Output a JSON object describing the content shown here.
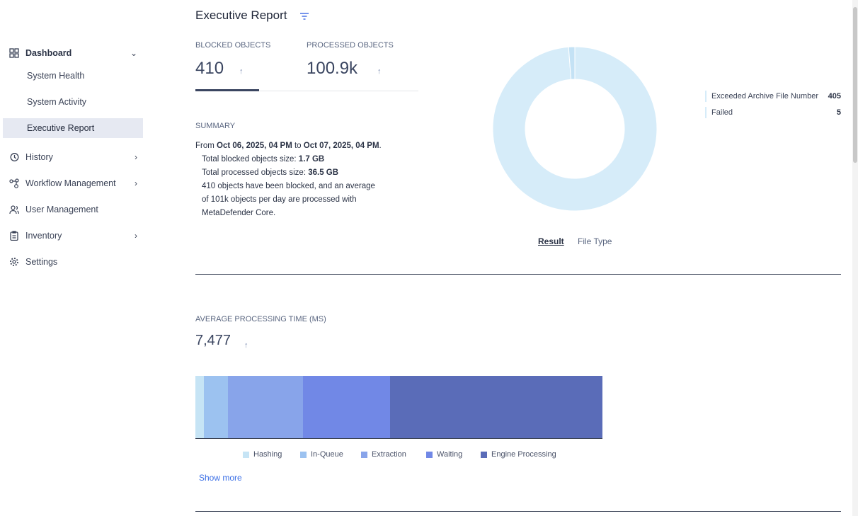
{
  "sidebar": {
    "items": [
      {
        "label": "Dashboard"
      },
      {
        "label": "System Health"
      },
      {
        "label": "System Activity"
      },
      {
        "label": "Executive Report"
      },
      {
        "label": "History"
      },
      {
        "label": "Workflow Management"
      },
      {
        "label": "User Management"
      },
      {
        "label": "Inventory"
      },
      {
        "label": "Settings"
      }
    ]
  },
  "header": {
    "title": "Executive Report"
  },
  "kpis": {
    "blocked_label": "BLOCKED OBJECTS",
    "blocked_value": "410",
    "processed_label": "PROCESSED OBJECTS",
    "processed_value": "100.9k",
    "arrow": "↑"
  },
  "summary": {
    "label": "SUMMARY",
    "from": "From ",
    "start": "Oct 06, 2025, 04 PM",
    "to": " to ",
    "end": "Oct 07, 2025, 04 PM",
    "end_punct": ".",
    "blocked_size_label": "Total blocked objects size: ",
    "blocked_size": "1.7 GB",
    "processed_size_label": "Total processed objects size: ",
    "processed_size": "36.5 GB",
    "line1": "410 objects have been blocked, and an average",
    "line2": "of 101k objects per day are processed with",
    "line3": "MetaDefender Core."
  },
  "donut": {
    "tabs": [
      "Result",
      "File Type"
    ],
    "active_tab": "Result"
  },
  "processing": {
    "label": "AVERAGE PROCESSING TIME (MS)",
    "value": "7,477",
    "arrow": "↑",
    "show_more": "Show more"
  },
  "chart_data": [
    {
      "type": "pie",
      "title": "Result",
      "categories": [
        "Exceeded Archive File Number",
        "Failed"
      ],
      "values": [
        405,
        5
      ],
      "colors": [
        "#d6ecf9",
        "#c4e2f5"
      ],
      "legend": "right"
    },
    {
      "type": "bar",
      "orientation": "horizontal-stacked",
      "title": "Average Processing Time (ms)",
      "categories": [
        "Hashing",
        "In-Queue",
        "Extraction",
        "Waiting",
        "Engine Processing"
      ],
      "values": [
        156,
        442,
        1378,
        1600,
        3901
      ],
      "colors": [
        "#c6e4f5",
        "#9cc2f0",
        "#88a4ea",
        "#7188e6",
        "#5a6cb8"
      ],
      "legend": "bottom"
    }
  ]
}
